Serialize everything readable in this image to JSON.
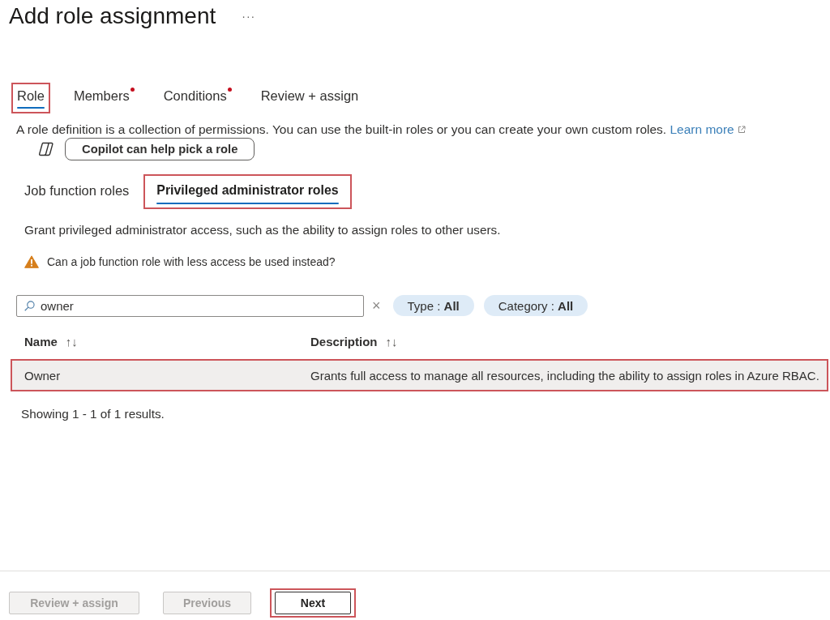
{
  "page": {
    "title": "Add role assignment",
    "more_menu": "···"
  },
  "tabs": [
    {
      "label": "Role",
      "selected": true,
      "required": false,
      "highlighted": true
    },
    {
      "label": "Members",
      "selected": false,
      "required": true,
      "highlighted": false
    },
    {
      "label": "Conditions",
      "selected": false,
      "required": true,
      "highlighted": false
    },
    {
      "label": "Review + assign",
      "selected": false,
      "required": false,
      "highlighted": false
    }
  ],
  "intro": {
    "text": "A role definition is a collection of permissions. You can use the built-in roles or you can create your own custom roles.",
    "link": "Learn more"
  },
  "copilot_button": "Copilot can help pick a role",
  "role_type_tabs": [
    {
      "label": "Job function roles",
      "selected": false,
      "highlighted": false
    },
    {
      "label": "Privileged administrator roles",
      "selected": true,
      "highlighted": true
    }
  ],
  "tab_description": "Grant privileged administrator access, such as the ability to assign roles to other users.",
  "warning": "Can a job function role with less access be used instead?",
  "search": {
    "value": "owner",
    "clear": "×"
  },
  "filters": [
    "Type : **All**",
    "Category : **All**"
  ],
  "table": {
    "columns": [
      {
        "label": "Name",
        "sort": "↑↓"
      },
      {
        "label": "Description",
        "sort": "↑↓"
      }
    ],
    "rows": [
      {
        "name": "Owner",
        "description": "Grants full access to manage all resources, including the ability to assign roles in Azure RBAC.",
        "selected": true,
        "highlighted": true
      }
    ]
  },
  "result_count": "Showing 1 - 1 of 1 results.",
  "footer_buttons": [
    {
      "label": "Review + assign",
      "disabled": true,
      "highlighted": false
    },
    {
      "label": "Previous",
      "disabled": true,
      "highlighted": false
    },
    {
      "label": "Next",
      "disabled": false,
      "highlighted": true
    }
  ]
}
